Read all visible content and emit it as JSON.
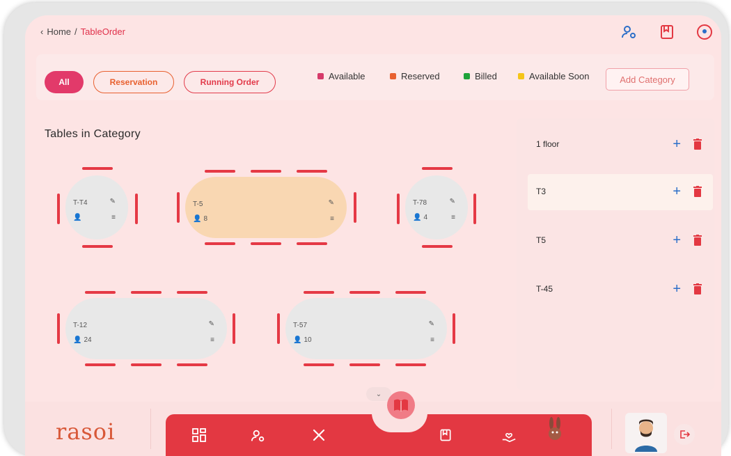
{
  "breadcrumb": {
    "back_glyph": "‹",
    "home": "Home",
    "separator": "/",
    "current": "TableOrder"
  },
  "filters": {
    "all": "All",
    "reservation": "Reservation",
    "running_order": "Running Order"
  },
  "legend": [
    {
      "label": "Available",
      "color": "#d63a6a"
    },
    {
      "label": "Reserved",
      "color": "#e8602f"
    },
    {
      "label": "Billed",
      "color": "#1fa33a"
    },
    {
      "label": "Available Soon",
      "color": "#f5c518"
    }
  ],
  "add_category": "Add Category",
  "tables_title": "Tables in Category",
  "tables": [
    {
      "name": "T-T4",
      "seats": ""
    },
    {
      "name": "T-5",
      "seats": "8"
    },
    {
      "name": "T-78",
      "seats": "4"
    },
    {
      "name": "T-12",
      "seats": "24"
    },
    {
      "name": "T-57",
      "seats": "10"
    }
  ],
  "categories": [
    {
      "label": "1 floor"
    },
    {
      "label": "T3"
    },
    {
      "label": "T5"
    },
    {
      "label": "T-45"
    }
  ],
  "brand": {
    "logo_text": "rasoi"
  },
  "icons": {
    "top": [
      "user-settings-icon",
      "book-icon",
      "location-icon"
    ],
    "nav": [
      "dashboard-icon",
      "user-settings-icon",
      "cutlery-icon",
      "menu-book-icon",
      "book-icon",
      "hand-heart-icon",
      "mascot-icon"
    ]
  },
  "colors": {
    "accent": "#e33842",
    "background": "#fde4e4",
    "reserved_table": "#f9d7b2",
    "free_table": "#e8e8e8"
  }
}
